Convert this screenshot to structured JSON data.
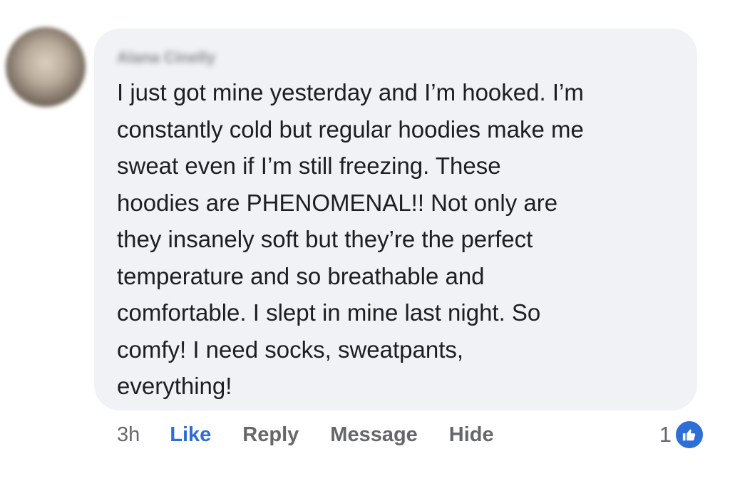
{
  "comment": {
    "author_name": "Alana Cinelly",
    "text_lines": [
      "I just got mine yesterday and I’m hooked. I’m",
      "constantly cold but regular hoodies make me",
      "sweat even if I’m still freezing. These",
      "hoodies are PHENOMENAL!! Not only are",
      "they insanely soft but they’re the perfect",
      "temperature and so breathable and",
      "comfortable. I slept in mine last night. So",
      "comfy! I need socks, sweatpants,",
      "everything!"
    ]
  },
  "actions": {
    "timestamp": "3h",
    "like_label": "Like",
    "reply_label": "Reply",
    "message_label": "Message",
    "hide_label": "Hide"
  },
  "reactions": {
    "count": "1",
    "icon": "thumbs-up-icon",
    "badge_color": "#2d6fd6"
  },
  "colors": {
    "bubble_bg": "#f0f2f5",
    "text": "#1c1e21",
    "secondary": "#65676b",
    "like_accent": "#2e6fd1"
  }
}
